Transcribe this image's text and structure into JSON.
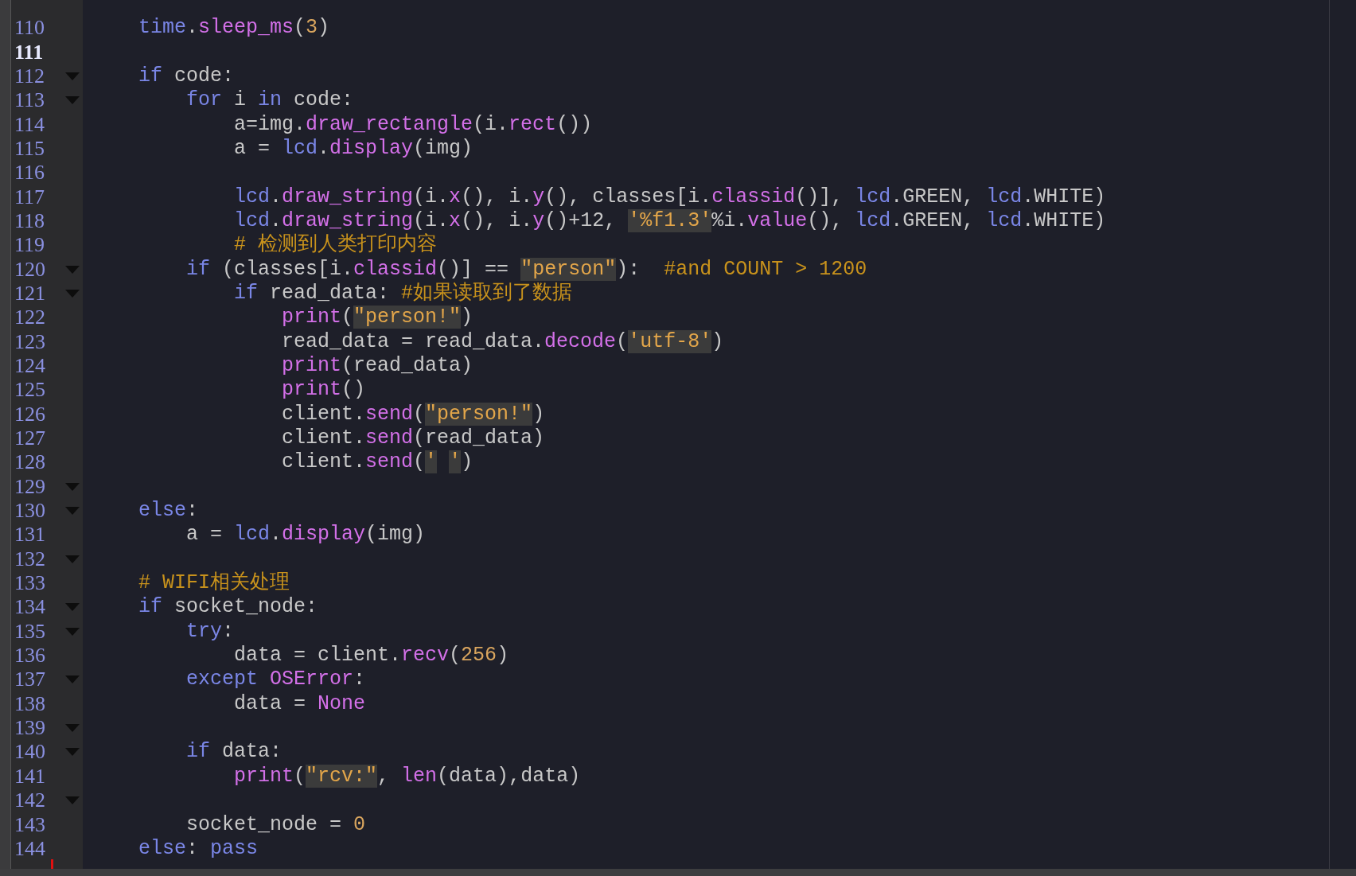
{
  "editor": {
    "lines": [
      {
        "number": "110",
        "fold": false,
        "current": false,
        "tokens": [
          {
            "kind": "keyword",
            "text": "    time"
          },
          {
            "kind": "plain",
            "text": "."
          },
          {
            "kind": "function",
            "text": "sleep_ms"
          },
          {
            "kind": "plain",
            "text": "("
          },
          {
            "kind": "number",
            "text": "3"
          },
          {
            "kind": "plain",
            "text": ")"
          }
        ]
      },
      {
        "number": "111",
        "fold": false,
        "current": true
      },
      {
        "number": "112",
        "fold": true,
        "current": false,
        "tokens": [
          {
            "kind": "keyword",
            "text": "    if"
          },
          {
            "kind": "plain",
            "text": " code:"
          }
        ]
      },
      {
        "number": "113",
        "fold": true,
        "current": false,
        "tokens": [
          {
            "kind": "keyword",
            "text": "        for"
          },
          {
            "kind": "plain",
            "text": " i "
          },
          {
            "kind": "keyword",
            "text": "in"
          },
          {
            "kind": "plain",
            "text": " code:"
          }
        ]
      },
      {
        "number": "114",
        "fold": false,
        "current": false,
        "tokens": [
          {
            "kind": "plain",
            "text": "            a=img."
          },
          {
            "kind": "function",
            "text": "draw_rectangle"
          },
          {
            "kind": "plain",
            "text": "(i."
          },
          {
            "kind": "function",
            "text": "rect"
          },
          {
            "kind": "plain",
            "text": "())"
          }
        ]
      },
      {
        "number": "115",
        "fold": false,
        "current": false,
        "tokens": [
          {
            "kind": "plain",
            "text": "            a = "
          },
          {
            "kind": "keyword",
            "text": "lcd"
          },
          {
            "kind": "plain",
            "text": "."
          },
          {
            "kind": "function",
            "text": "display"
          },
          {
            "kind": "plain",
            "text": "(img)"
          }
        ]
      },
      {
        "number": "116",
        "fold": false,
        "current": false
      },
      {
        "number": "117",
        "fold": false,
        "current": false,
        "tokens": [
          {
            "kind": "keyword",
            "text": "            lcd"
          },
          {
            "kind": "plain",
            "text": "."
          },
          {
            "kind": "function",
            "text": "draw_string"
          },
          {
            "kind": "plain",
            "text": "(i."
          },
          {
            "kind": "function",
            "text": "x"
          },
          {
            "kind": "plain",
            "text": "(), i."
          },
          {
            "kind": "function",
            "text": "y"
          },
          {
            "kind": "plain",
            "text": "(), classes[i."
          },
          {
            "kind": "function",
            "text": "classid"
          },
          {
            "kind": "plain",
            "text": "()], "
          },
          {
            "kind": "keyword",
            "text": "lcd"
          },
          {
            "kind": "plain",
            "text": ".GREEN, "
          },
          {
            "kind": "keyword",
            "text": "lcd"
          },
          {
            "kind": "plain",
            "text": ".WHITE)"
          }
        ]
      },
      {
        "number": "118",
        "fold": false,
        "current": false,
        "tokens": [
          {
            "kind": "keyword",
            "text": "            lcd"
          },
          {
            "kind": "plain",
            "text": "."
          },
          {
            "kind": "function",
            "text": "draw_string"
          },
          {
            "kind": "plain",
            "text": "(i."
          },
          {
            "kind": "function",
            "text": "x"
          },
          {
            "kind": "plain",
            "text": "(), i."
          },
          {
            "kind": "function",
            "text": "y"
          },
          {
            "kind": "plain",
            "text": "()+12, "
          },
          {
            "kind": "string",
            "text": "'%f1.3'"
          },
          {
            "kind": "plain",
            "text": "%i."
          },
          {
            "kind": "function",
            "text": "value"
          },
          {
            "kind": "plain",
            "text": "(), "
          },
          {
            "kind": "keyword",
            "text": "lcd"
          },
          {
            "kind": "plain",
            "text": ".GREEN, "
          },
          {
            "kind": "keyword",
            "text": "lcd"
          },
          {
            "kind": "plain",
            "text": ".WHITE)"
          }
        ]
      },
      {
        "number": "119",
        "fold": false,
        "current": false,
        "tokens": [
          {
            "kind": "comment",
            "text": "            # 检测到人类打印内容"
          }
        ]
      },
      {
        "number": "120",
        "fold": true,
        "current": false,
        "tokens": [
          {
            "kind": "keyword",
            "text": "        if"
          },
          {
            "kind": "plain",
            "text": " (classes[i."
          },
          {
            "kind": "function",
            "text": "classid"
          },
          {
            "kind": "plain",
            "text": "()] == "
          },
          {
            "kind": "string",
            "text": "\"person\""
          },
          {
            "kind": "plain",
            "text": "):  "
          },
          {
            "kind": "comment",
            "text": "#and COUNT > 1200"
          }
        ]
      },
      {
        "number": "121",
        "fold": true,
        "current": false,
        "tokens": [
          {
            "kind": "keyword",
            "text": "            if"
          },
          {
            "kind": "plain",
            "text": " read_data: "
          },
          {
            "kind": "comment",
            "text": "#如果读取到了数据"
          }
        ]
      },
      {
        "number": "122",
        "fold": false,
        "current": false,
        "tokens": [
          {
            "kind": "function",
            "text": "                print"
          },
          {
            "kind": "plain",
            "text": "("
          },
          {
            "kind": "string",
            "text": "\"person!\""
          },
          {
            "kind": "plain",
            "text": ")"
          }
        ]
      },
      {
        "number": "123",
        "fold": false,
        "current": false,
        "tokens": [
          {
            "kind": "plain",
            "text": "                read_data = read_data."
          },
          {
            "kind": "function",
            "text": "decode"
          },
          {
            "kind": "plain",
            "text": "("
          },
          {
            "kind": "string",
            "text": "'utf-8'"
          },
          {
            "kind": "plain",
            "text": ")"
          }
        ]
      },
      {
        "number": "124",
        "fold": false,
        "current": false,
        "tokens": [
          {
            "kind": "function",
            "text": "                print"
          },
          {
            "kind": "plain",
            "text": "(read_data)"
          }
        ]
      },
      {
        "number": "125",
        "fold": false,
        "current": false,
        "tokens": [
          {
            "kind": "function",
            "text": "                print"
          },
          {
            "kind": "plain",
            "text": "()"
          }
        ]
      },
      {
        "number": "126",
        "fold": false,
        "current": false,
        "tokens": [
          {
            "kind": "plain",
            "text": "                client."
          },
          {
            "kind": "function",
            "text": "send"
          },
          {
            "kind": "plain",
            "text": "("
          },
          {
            "kind": "string",
            "text": "\"person!\""
          },
          {
            "kind": "plain",
            "text": ")"
          }
        ]
      },
      {
        "number": "127",
        "fold": false,
        "current": false,
        "tokens": [
          {
            "kind": "plain",
            "text": "                client."
          },
          {
            "kind": "function",
            "text": "send"
          },
          {
            "kind": "plain",
            "text": "(read_data)"
          }
        ]
      },
      {
        "number": "128",
        "fold": false,
        "current": false,
        "tokens": [
          {
            "kind": "plain",
            "text": "                client."
          },
          {
            "kind": "function",
            "text": "send"
          },
          {
            "kind": "plain",
            "text": "("
          },
          {
            "kind": "quotes",
            "text": "' '"
          },
          {
            "kind": "plain",
            "text": ")"
          }
        ]
      },
      {
        "number": "129",
        "fold": true,
        "current": false
      },
      {
        "number": "130",
        "fold": true,
        "current": false,
        "tokens": [
          {
            "kind": "keyword",
            "text": "    else"
          },
          {
            "kind": "plain",
            "text": ":"
          }
        ]
      },
      {
        "number": "131",
        "fold": false,
        "current": false,
        "tokens": [
          {
            "kind": "plain",
            "text": "        a = "
          },
          {
            "kind": "keyword",
            "text": "lcd"
          },
          {
            "kind": "plain",
            "text": "."
          },
          {
            "kind": "function",
            "text": "display"
          },
          {
            "kind": "plain",
            "text": "(img)"
          }
        ]
      },
      {
        "number": "132",
        "fold": true,
        "current": false
      },
      {
        "number": "133",
        "fold": false,
        "current": false,
        "tokens": [
          {
            "kind": "comment",
            "text": "    # WIFI相关处理"
          }
        ]
      },
      {
        "number": "134",
        "fold": true,
        "current": false,
        "tokens": [
          {
            "kind": "keyword",
            "text": "    if"
          },
          {
            "kind": "plain",
            "text": " socket_node:"
          }
        ]
      },
      {
        "number": "135",
        "fold": true,
        "current": false,
        "tokens": [
          {
            "kind": "keyword",
            "text": "        try"
          },
          {
            "kind": "plain",
            "text": ":"
          }
        ]
      },
      {
        "number": "136",
        "fold": false,
        "current": false,
        "tokens": [
          {
            "kind": "plain",
            "text": "            data = client."
          },
          {
            "kind": "function",
            "text": "recv"
          },
          {
            "kind": "plain",
            "text": "("
          },
          {
            "kind": "number",
            "text": "256"
          },
          {
            "kind": "plain",
            "text": ")"
          }
        ]
      },
      {
        "number": "137",
        "fold": true,
        "current": false,
        "tokens": [
          {
            "kind": "keyword",
            "text": "        except"
          },
          {
            "kind": "function",
            "text": " OSError"
          },
          {
            "kind": "plain",
            "text": ":"
          }
        ]
      },
      {
        "number": "138",
        "fold": false,
        "current": false,
        "tokens": [
          {
            "kind": "plain",
            "text": "            data = "
          },
          {
            "kind": "function",
            "text": "None"
          }
        ]
      },
      {
        "number": "139",
        "fold": true,
        "current": false
      },
      {
        "number": "140",
        "fold": true,
        "current": false,
        "tokens": [
          {
            "kind": "keyword",
            "text": "        if"
          },
          {
            "kind": "plain",
            "text": " data:"
          }
        ]
      },
      {
        "number": "141",
        "fold": false,
        "current": false,
        "tokens": [
          {
            "kind": "function",
            "text": "            print"
          },
          {
            "kind": "plain",
            "text": "("
          },
          {
            "kind": "string",
            "text": "\"rcv:\""
          },
          {
            "kind": "plain",
            "text": ", "
          },
          {
            "kind": "function",
            "text": "len"
          },
          {
            "kind": "plain",
            "text": "(data),data)"
          }
        ]
      },
      {
        "number": "142",
        "fold": true,
        "current": false
      },
      {
        "number": "143",
        "fold": false,
        "current": false,
        "tokens": [
          {
            "kind": "plain",
            "text": "        socket_node = "
          },
          {
            "kind": "number",
            "text": "0"
          }
        ]
      },
      {
        "number": "144",
        "fold": false,
        "current": false,
        "tokens": [
          {
            "kind": "keyword",
            "text": "    else"
          },
          {
            "kind": "plain",
            "text": ": "
          },
          {
            "kind": "keyword",
            "text": "pass"
          }
        ]
      }
    ]
  }
}
